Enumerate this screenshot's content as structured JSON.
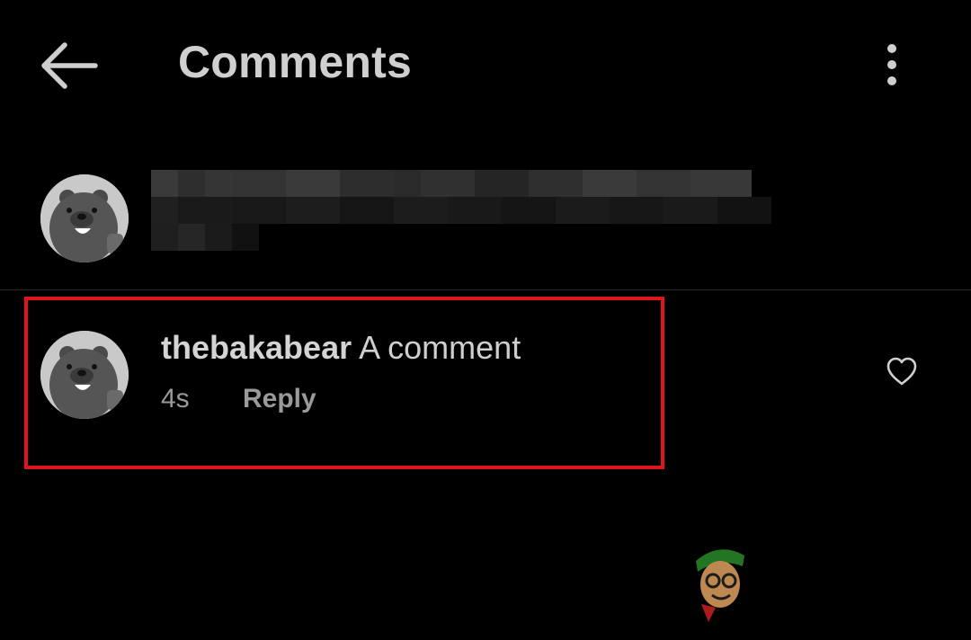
{
  "header": {
    "title": "Comments",
    "back_icon": "arrow-left-icon",
    "more_icon": "more-vertical-icon"
  },
  "caption": {
    "avatar_icon": "bear-avatar"
  },
  "comment": {
    "username": "thebakabear",
    "text": "A comment",
    "timestamp": "4s",
    "reply_label": "Reply",
    "like_icon": "heart-outline-icon"
  },
  "colors": {
    "background": "#000000",
    "text": "#cfcfcf",
    "muted": "#9a9a9a",
    "highlight": "#e0141b"
  }
}
